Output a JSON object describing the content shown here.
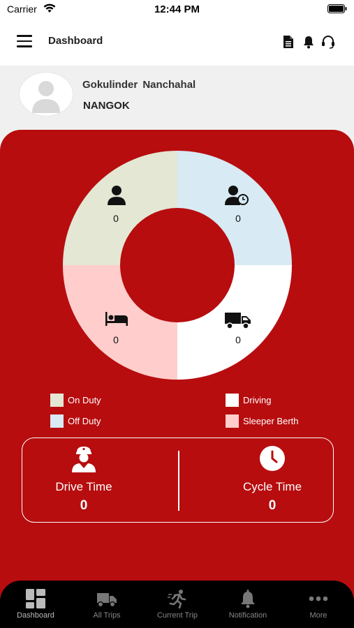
{
  "status_bar": {
    "carrier": "Carrier",
    "time": "12:44 PM"
  },
  "header": {
    "title": "Dashboard",
    "icons": [
      "menu-icon",
      "document-icon",
      "bell-icon",
      "headset-icon"
    ]
  },
  "profile": {
    "name": "Gokulinder  Nanchahal",
    "company": "NANGOK"
  },
  "duty_chart": {
    "segments": [
      {
        "key": "on_duty",
        "value": "0",
        "color": "#e3e7d3",
        "icon": "user-icon"
      },
      {
        "key": "off_duty",
        "value": "0",
        "color": "#d8eaf3",
        "icon": "user-clock-icon"
      },
      {
        "key": "driving",
        "value": "0",
        "color": "#ffffff",
        "icon": "truck-icon"
      },
      {
        "key": "sleeper_berth",
        "value": "0",
        "color": "#ffcdcb",
        "icon": "bed-icon"
      }
    ]
  },
  "legend": [
    {
      "label": "On Duty",
      "color": "#e3e7d3"
    },
    {
      "label": "Off Duty",
      "color": "#d8eaf3"
    },
    {
      "label": "Driving",
      "color": "#ffffff"
    },
    {
      "label": "Sleeper Berth",
      "color": "#ffcdcb"
    }
  ],
  "time_card": {
    "drive_label": "Drive Time",
    "drive_value": "0",
    "cycle_label": "Cycle Time",
    "cycle_value": "0"
  },
  "bottom_nav": [
    {
      "label": "Dashboard",
      "icon": "dashboard-icon",
      "active": true
    },
    {
      "label": "All Trips",
      "icon": "trips-icon",
      "active": false
    },
    {
      "label": "Current Trip",
      "icon": "runner-icon",
      "active": false
    },
    {
      "label": "Notification",
      "icon": "bell-icon",
      "active": false
    },
    {
      "label": "More",
      "icon": "more-icon",
      "active": false
    }
  ],
  "colors": {
    "brand_red": "#b70d0f",
    "nav_bg": "#000000"
  }
}
